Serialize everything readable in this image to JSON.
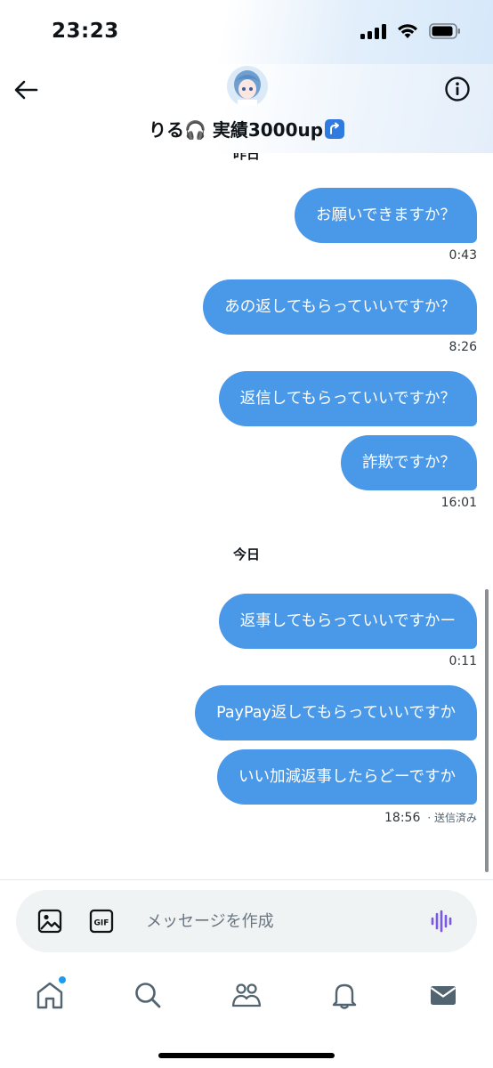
{
  "status_bar": {
    "time": "23:23"
  },
  "header": {
    "name": "りる🎧 実績3000up"
  },
  "chat": {
    "cut_off_date": "昨日",
    "today_label": "今日",
    "messages": [
      {
        "text": "お願いできますか？"
      },
      {
        "text": "あの返してもらっていいですか？"
      },
      {
        "text": "返信してもらっていいですか？"
      },
      {
        "text": "詐欺ですか？"
      },
      {
        "text": "返事してもらっていいですかー"
      },
      {
        "text": "PayPay返してもらっていいですか"
      },
      {
        "text": "いい加減返事したらどーですか"
      }
    ],
    "timestamps": [
      "0:43",
      "8:26",
      "16:01",
      "0:11",
      "18:56"
    ],
    "sent_status": "· 送信済み"
  },
  "composer": {
    "placeholder": "メッセージを作成"
  },
  "tabs": [
    "home-icon",
    "search-icon",
    "communities-icon",
    "notifications-icon",
    "messages-icon"
  ]
}
